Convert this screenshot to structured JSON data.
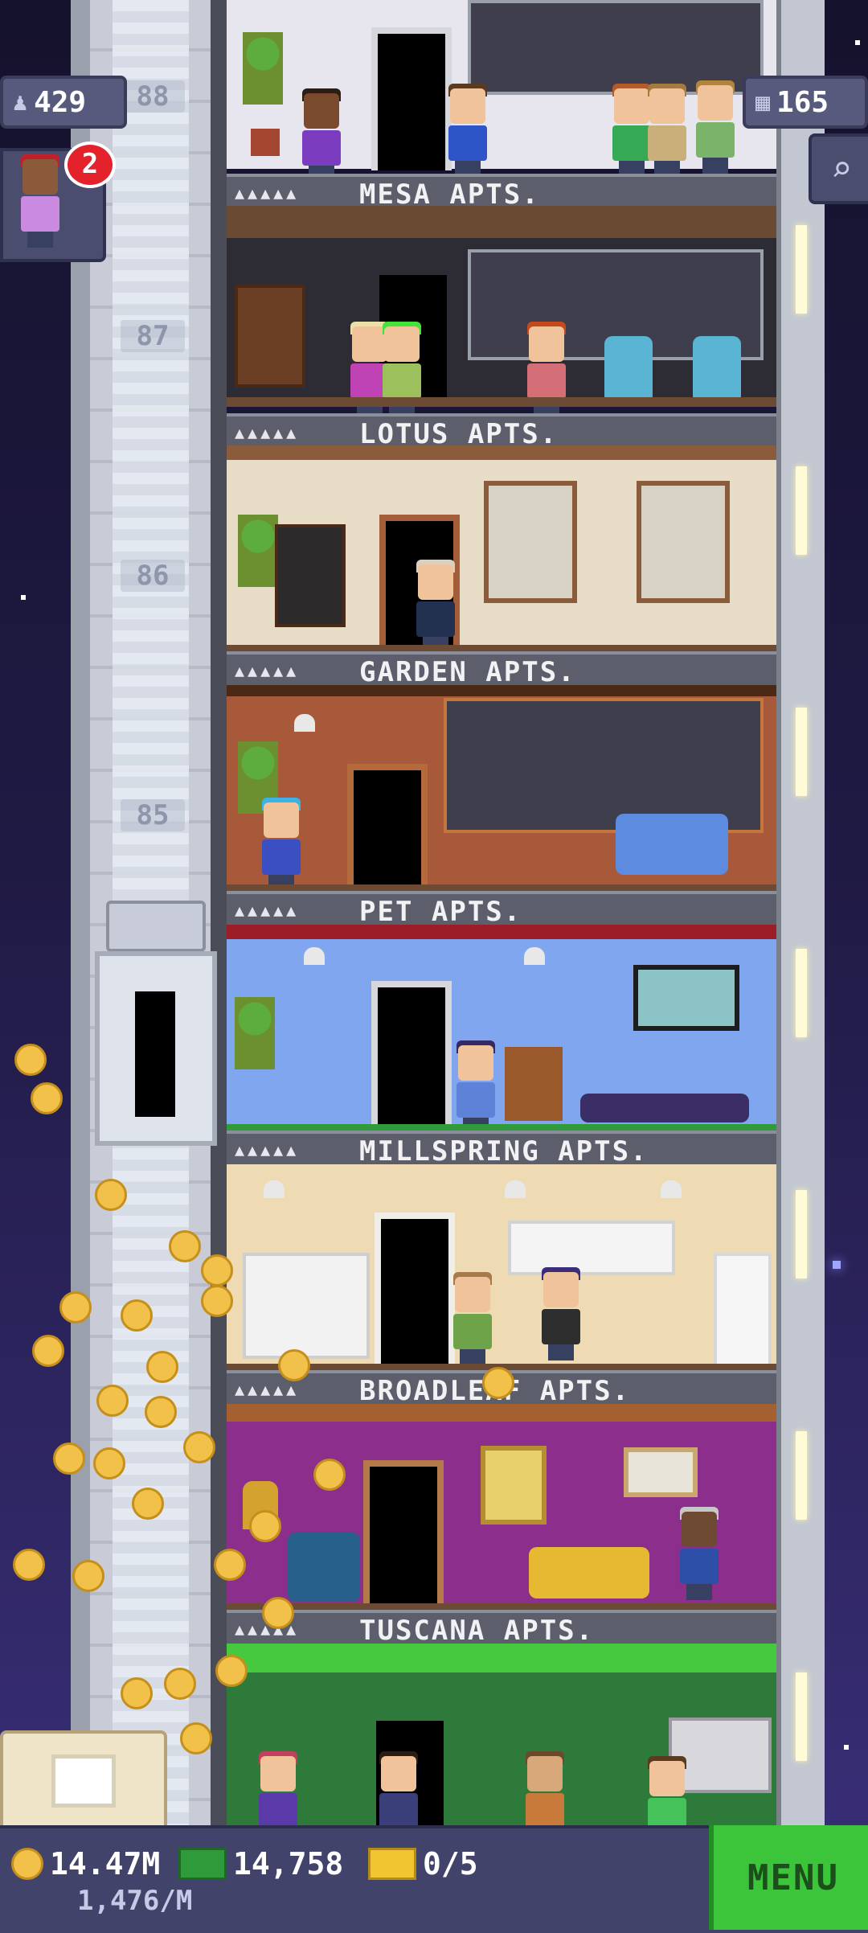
{
  "hud": {
    "population": "429",
    "floors_count": "165",
    "notification_count": "2",
    "population_icon": "person-icon",
    "floors_icon": "building-icon",
    "search_icon": "magnifier-icon"
  },
  "floor_numbers": [
    "88",
    "87",
    "86",
    "85"
  ],
  "floors": [
    {
      "name": "MESA APTS.",
      "dots": "▲▲▲▲▲",
      "wall": "#2d2b33"
    },
    {
      "name": "LOTUS APTS.",
      "dots": "▲▲▲▲▲",
      "wall": "#e7dcc5"
    },
    {
      "name": "GARDEN APTS.",
      "dots": "▲▲▲▲▲",
      "wall": "#a7593a"
    },
    {
      "name": "PET APTS.",
      "dots": "▲▲▲▲▲",
      "wall": "#7fa6ef"
    },
    {
      "name": "MILLSPRING APTS.",
      "dots": "▲▲▲▲▲",
      "wall": "#eedbb4"
    },
    {
      "name": "BROADLEAF APTS.",
      "dots": "▲▲▲▲▲",
      "wall": "#8c2f8c"
    },
    {
      "name": "TUSCANA APTS.",
      "dots": "▲▲▲▲▲",
      "wall": "#2e7a3a"
    }
  ],
  "bottom": {
    "coins": "14.47M",
    "bux": "14,758",
    "tickets": "0/5",
    "rate": "1,476/M",
    "menu_label": "MENU"
  },
  "colors": {
    "menu_green": "#3cc43a",
    "coin_gold": "#f2c14a",
    "badge_red": "#e3222b",
    "hud_bg": "#57597d"
  }
}
